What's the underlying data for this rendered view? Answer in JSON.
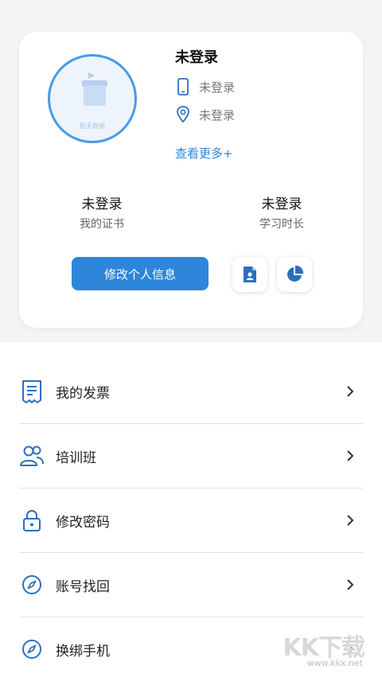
{
  "profile": {
    "avatar_caption": "暂无数据",
    "name": "未登录",
    "phone": "未登录",
    "location": "未登录",
    "more_link": "查看更多+"
  },
  "stats": [
    {
      "value": "未登录",
      "label": "我的证书"
    },
    {
      "value": "未登录",
      "label": "学习时长"
    }
  ],
  "actions": {
    "edit_profile": "修改个人信息"
  },
  "menu": [
    {
      "label": "我的发票",
      "icon": "receipt-icon"
    },
    {
      "label": "培训班",
      "icon": "group-icon"
    },
    {
      "label": "修改密码",
      "icon": "lock-icon"
    },
    {
      "label": "账号找回",
      "icon": "compass-icon"
    },
    {
      "label": "换绑手机",
      "icon": "compass-icon"
    }
  ],
  "watermark": {
    "logo": "KK下载",
    "url": "www.kkx.net"
  },
  "colors": {
    "accent": "#2d86d9",
    "icon": "#2b6fc1"
  }
}
